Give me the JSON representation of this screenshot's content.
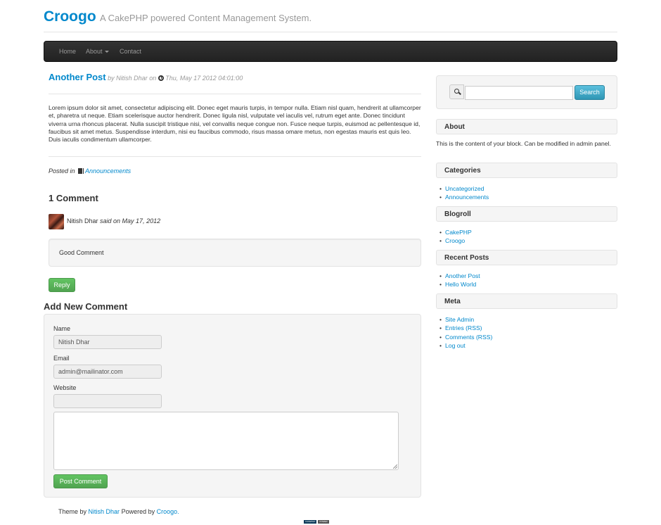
{
  "header": {
    "brand": "Croogo",
    "tagline": "A CakePHP powered Content Management System."
  },
  "nav": {
    "items": [
      {
        "label": "Home"
      },
      {
        "label": "About"
      },
      {
        "label": "Contact"
      }
    ]
  },
  "post": {
    "title": "Another Post",
    "by": "by",
    "author": "Nitish Dhar",
    "on": "on",
    "date": "Thu, May 17 2012 04:01:00",
    "body": "Lorem ipsum dolor sit amet, consectetur adipiscing elit. Donec eget mauris turpis, in tempor nulla. Etiam nisl quam, hendrerit at ullamcorper et, pharetra ut neque. Etiam scelerisque auctor hendrerit. Donec ligula nisl, vulputate vel iaculis vel, rutrum eget ante. Donec tincidunt viverra urna rhoncus placerat. Nulla suscipit tristique nisi, vel convallis neque congue non. Fusce neque turpis, euismod ac pellentesque id, faucibus sit amet metus. Suspendisse interdum, nisi eu faucibus commodo, risus massa omare metus, non egestas mauris est quis leo. Duis iaculis condimentum ullamcorper.",
    "posted_in_label": "Posted in",
    "category": "Announcements"
  },
  "comments": {
    "heading": "1 Comment",
    "items": [
      {
        "author": "Nitish Dhar",
        "said_on": "said on May 17, 2012",
        "text": "Good Comment"
      }
    ],
    "reply_label": "Reply"
  },
  "comment_form": {
    "heading": "Add New Comment",
    "name_label": "Name",
    "name_value": "Nitish Dhar",
    "email_label": "Email",
    "email_value": "admin@mailinator.com",
    "website_label": "Website",
    "website_value": "",
    "submit_label": "Post Comment"
  },
  "footer": {
    "theme_by": "Theme by",
    "theme_author": "Nitish Dhar",
    "powered_by": "Powered by",
    "powered_link": "Croogo.",
    "badges": [
      "CAKEPHP",
      "POWER"
    ]
  },
  "sidebar": {
    "search_button": "Search",
    "about": {
      "title": "About",
      "text": "This is the content of your block. Can be modified in admin panel."
    },
    "categories": {
      "title": "Categories",
      "items": [
        "Uncategorized",
        "Announcements"
      ]
    },
    "blogroll": {
      "title": "Blogroll",
      "items": [
        "CakePHP",
        "Croogo"
      ]
    },
    "recent_posts": {
      "title": "Recent Posts",
      "items": [
        "Another Post",
        "Hello World"
      ]
    },
    "meta": {
      "title": "Meta",
      "items": [
        "Site Admin",
        "Entries (RSS)",
        "Comments (RSS)",
        "Log out"
      ]
    }
  },
  "colors": {
    "link": "#0088cc",
    "navbar": "#222222",
    "success": "#51a351",
    "info": "#2f96b4"
  }
}
